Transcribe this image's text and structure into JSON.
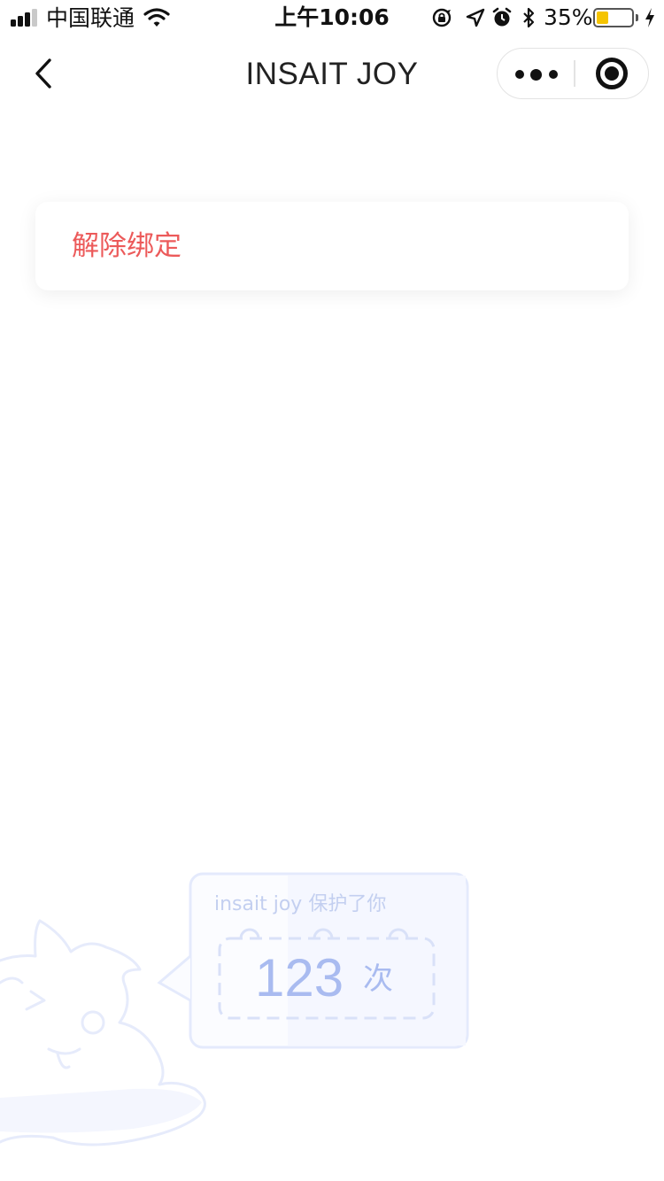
{
  "status_bar": {
    "carrier": "中国联通",
    "time": "上午10:06",
    "battery_percent": "35%",
    "battery_level": 0.35,
    "icons": [
      "signal-icon",
      "wifi-icon",
      "orientation-lock-icon",
      "location-icon",
      "alarm-icon",
      "bluetooth-icon",
      "battery-icon",
      "charging-icon"
    ]
  },
  "nav": {
    "title": "INSAIT JOY",
    "icons": [
      "back-arrow-icon",
      "more-dots-icon",
      "close-target-icon"
    ]
  },
  "card": {
    "unbind_label": "解除绑定"
  },
  "protection": {
    "text": "insait joy 保护了你",
    "count": "123",
    "unit": "次"
  },
  "colors": {
    "danger": "#ec5a5a",
    "illustration_accent": "#a9bbf0",
    "illustration_stroke": "#dfe6fb"
  }
}
